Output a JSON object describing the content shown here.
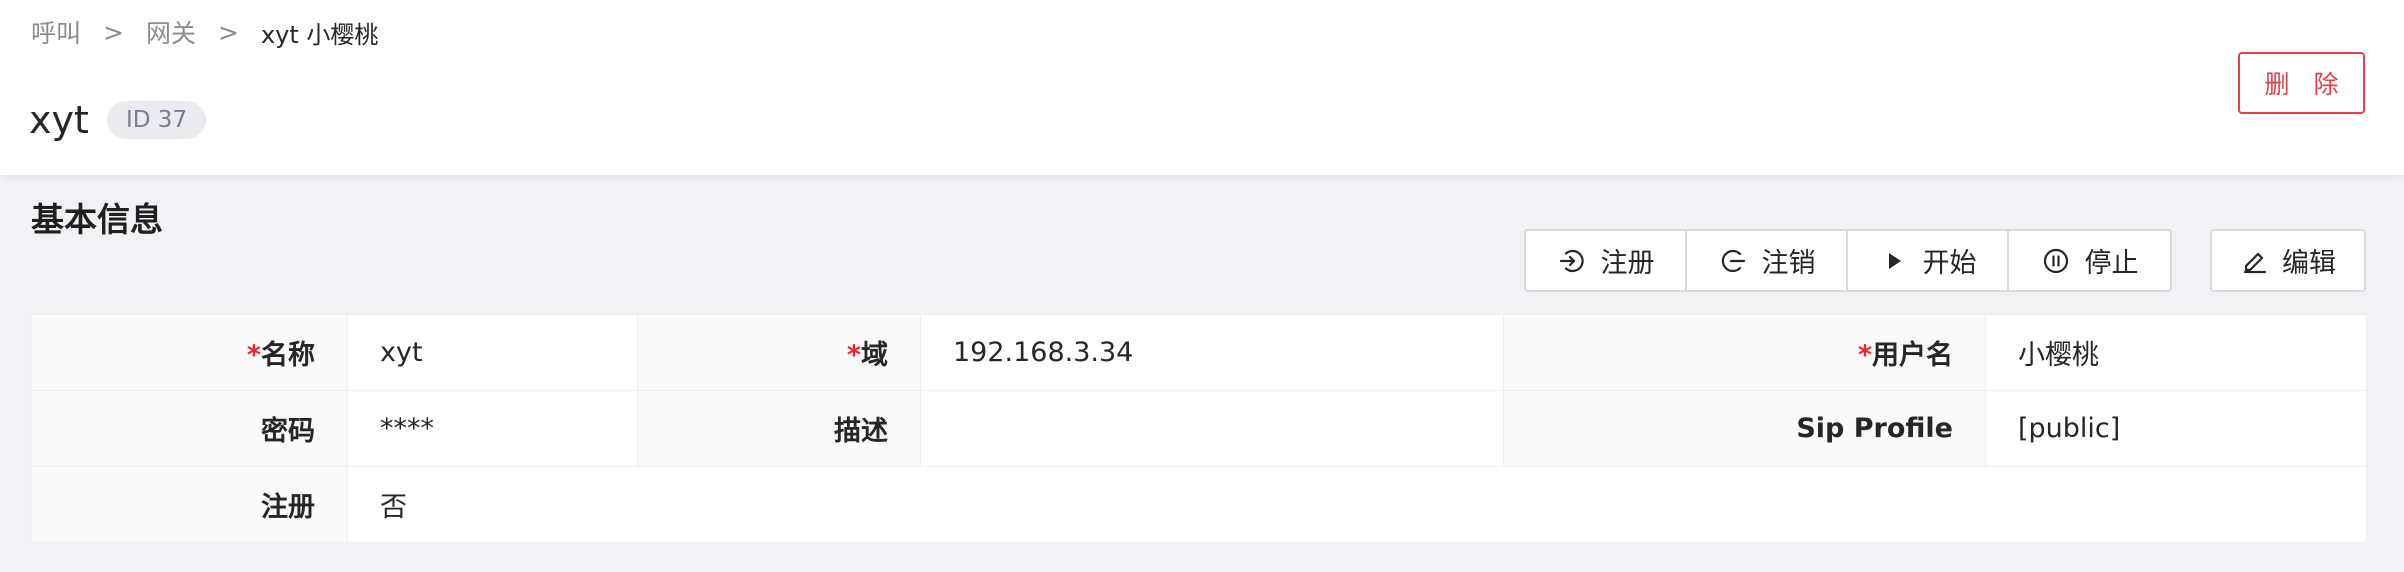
{
  "breadcrumb": {
    "items": [
      "呼叫",
      "网关"
    ],
    "separator": ">",
    "current": "xyt 小樱桃"
  },
  "title": "xyt",
  "id_badge": "ID 37",
  "delete_label": "删 除",
  "section_title": "基本信息",
  "actions": {
    "register": "注册",
    "unregister": "注销",
    "start": "开始",
    "stop": "停止",
    "edit": "编辑"
  },
  "fields": {
    "name": {
      "label": "名称",
      "value": "xyt",
      "required": true
    },
    "domain": {
      "label": "域",
      "value": "192.168.3.34",
      "required": true
    },
    "username": {
      "label": "用户名",
      "value": "小樱桃",
      "required": true
    },
    "password": {
      "label": "密码",
      "value": "****"
    },
    "description": {
      "label": "描述",
      "value": ""
    },
    "sip_profile": {
      "label": "Sip Profile",
      "value": "[public]"
    },
    "register": {
      "label": "注册",
      "value": "否"
    }
  },
  "colors": {
    "danger": "#e0424b",
    "required": "#f5222d",
    "page_bg": "#f0f2f5"
  }
}
